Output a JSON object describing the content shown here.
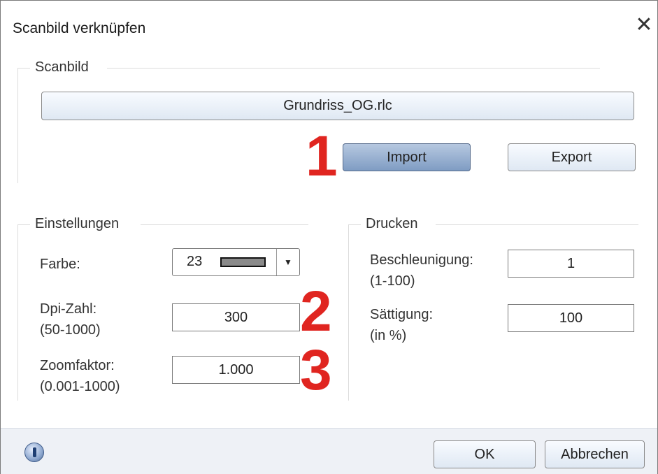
{
  "dialog": {
    "title": "Scanbild verknüpfen",
    "close_glyph": "✕"
  },
  "scanbild": {
    "label": "Scanbild",
    "file_button": "Grundriss_OG.rlc",
    "import_button": "Import",
    "export_button": "Export"
  },
  "einstellungen": {
    "label": "Einstellungen",
    "farbe_label": "Farbe:",
    "farbe_value": "23",
    "farbe_swatch_color": "#8a8a8a",
    "dpi_label": "Dpi-Zahl:",
    "dpi_range": "(50-1000)",
    "dpi_value": "300",
    "zoom_label": "Zoomfaktor:",
    "zoom_range": "(0.001-1000)",
    "zoom_value": "1.000"
  },
  "drucken": {
    "label": "Drucken",
    "beschleunigung_label": "Beschleunigung:",
    "beschleunigung_range": "(1-100)",
    "beschleunigung_value": "1",
    "saettigung_label": "Sättigung:",
    "saettigung_range": "(in %)",
    "saettigung_value": "100"
  },
  "markers": {
    "m1": "1",
    "m2": "2",
    "m3": "3",
    "color": "#e02520"
  },
  "footer": {
    "ok_button": "OK",
    "cancel_button": "Abbrechen",
    "info_icon": "info-icon"
  }
}
